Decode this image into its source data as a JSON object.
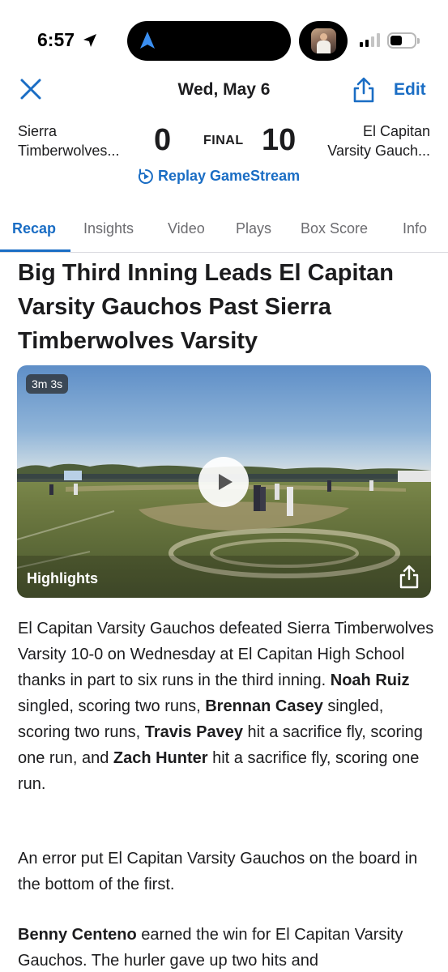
{
  "status_bar": {
    "time": "6:57",
    "icons": [
      "location-arrow-icon",
      "dynamic-island-nav-icon",
      "signal-icon",
      "battery-icon"
    ]
  },
  "header": {
    "date": "Wed, May 6",
    "edit_label": "Edit",
    "icons": [
      "close-icon",
      "share-icon"
    ]
  },
  "scoreboard": {
    "home_team_line1": "Sierra",
    "home_team_line2": "Timberwolves...",
    "home_score": "0",
    "status": "FINAL",
    "away_score": "10",
    "away_team_line1": "El Capitan",
    "away_team_line2": "Varsity Gauch...",
    "replay_label": "Replay GameStream"
  },
  "tabs": [
    {
      "label": "Recap",
      "active": true
    },
    {
      "label": "Insights",
      "active": false
    },
    {
      "label": "Video",
      "active": false
    },
    {
      "label": "Plays",
      "active": false
    },
    {
      "label": "Box Score",
      "active": false
    },
    {
      "label": "Info",
      "active": false
    }
  ],
  "article": {
    "headline": "Big Third Inning Leads El Capitan Varsity Gauchos Past Sierra Timberwolves Varsity",
    "video": {
      "duration": "3m 3s",
      "label": "Highlights"
    },
    "p1": {
      "t1": "El Capitan Varsity Gauchos defeated Sierra Timberwolves Varsity 10-0 on Wednesday at El Capitan High School thanks in part to six runs in the third inning.  ",
      "n1": "Noah Ruiz",
      "t2": " singled, scoring two runs, ",
      "n2": "Brennan Casey",
      "t3": " singled, scoring two runs, ",
      "n3": "Travis Pavey",
      "t4": " hit a sacrifice fly, scoring one run, and ",
      "n4": "Zach Hunter",
      "t5": " hit a sacrifice fly, scoring one run."
    },
    "p2": "An error put El Capitan Varsity Gauchos on the board in the bottom of the first.",
    "p3": {
      "n1": "Benny Centeno",
      "t1": " earned the win for El Capitan Varsity Gauchos. The hurler gave up two hits and"
    }
  },
  "colors": {
    "accent": "#1a6dc4",
    "text": "#1c1c1e",
    "muted": "#6c6c70"
  }
}
